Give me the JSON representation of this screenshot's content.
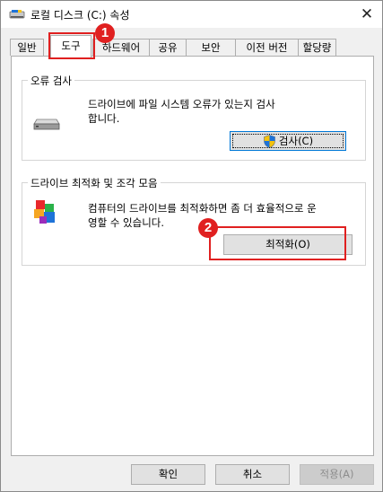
{
  "window": {
    "title": "로컬 디스크 (C:) 속성",
    "close_glyph": "✕"
  },
  "tabs": [
    {
      "label": "일반"
    },
    {
      "label": "도구",
      "active": true
    },
    {
      "label": "하드웨어"
    },
    {
      "label": "공유"
    },
    {
      "label": "보안"
    },
    {
      "label": "이전 버전"
    },
    {
      "label": "할당량"
    }
  ],
  "error_check": {
    "title": "오류 검사",
    "desc_line1": "드라이브에 파일 시스템 오류가 있는지 검사",
    "desc_line2": "합니다.",
    "button_label": "검사(C)",
    "icon": "drive-icon"
  },
  "optimize": {
    "title": "드라이브 최적화 및 조각 모음",
    "desc_line1": "컴퓨터의 드라이브를 최적화하면 좀 더 효율적으로 운",
    "desc_line2": "영할 수 있습니다.",
    "button_label": "최적화(O)",
    "icon": "defrag-icon"
  },
  "annotations": [
    {
      "number": "1"
    },
    {
      "number": "2"
    }
  ],
  "footer": {
    "ok": "확인",
    "cancel": "취소",
    "apply": "적용(A)"
  }
}
